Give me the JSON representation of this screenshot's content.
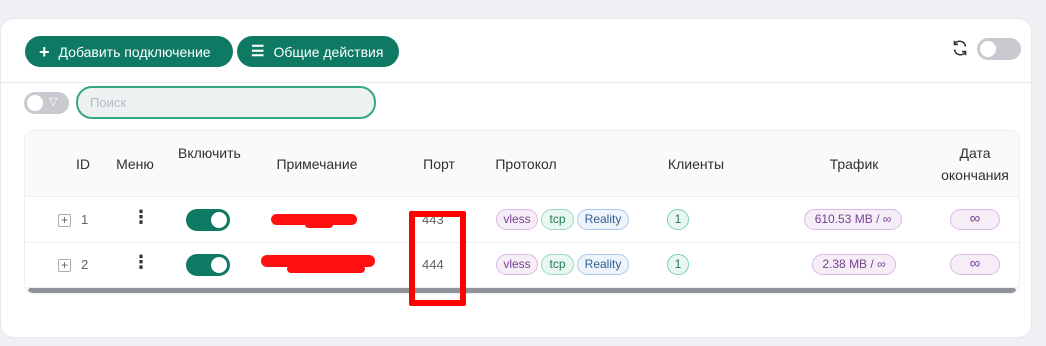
{
  "header": {
    "add_label": "Добавить подключение",
    "add_glyph": "+",
    "actions_label": "Общие действия",
    "actions_glyph": "☰"
  },
  "filter": {
    "search_placeholder": "Поиск",
    "filter_glyph": "▽"
  },
  "table": {
    "columns": {
      "id": "ID",
      "menu": "Меню",
      "enable": "Включить",
      "remark": "Примечание",
      "port": "Порт",
      "protocol": "Протокол",
      "clients": "Клиенты",
      "traffic": "Трафик",
      "expiry": "Дата окончания"
    },
    "rows": [
      {
        "expand": "+",
        "id": "1",
        "menu": "⋮",
        "enabled": true,
        "remark": "",
        "port": "443",
        "protocol": {
          "proto": "vless",
          "network": "tcp",
          "security": "Reality"
        },
        "clients": "1",
        "traffic": "610.53 MB / ∞",
        "expiry": "∞"
      },
      {
        "expand": "+",
        "id": "2",
        "menu": "⋮",
        "enabled": true,
        "remark": "",
        "port": "444",
        "protocol": {
          "proto": "vless",
          "network": "tcp",
          "security": "Reality"
        },
        "clients": "1",
        "traffic": "2.38 MB / ∞",
        "expiry": "∞"
      }
    ]
  },
  "colors": {
    "primary": "#0e7a64",
    "annotation": "#ff0000",
    "background": "#eef0f3"
  }
}
